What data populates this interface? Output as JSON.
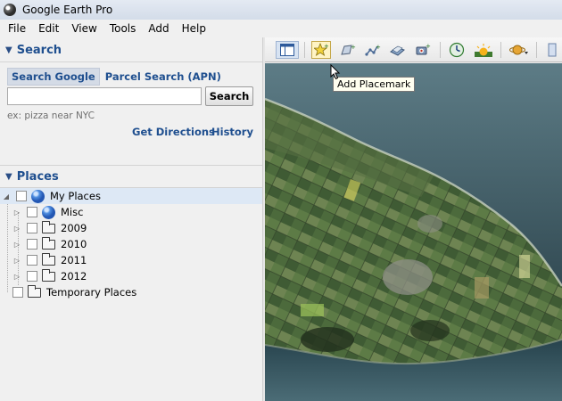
{
  "window": {
    "title": "Google Earth Pro",
    "app_icon": "google-earth-icon"
  },
  "menu": [
    "File",
    "Edit",
    "View",
    "Tools",
    "Add",
    "Help"
  ],
  "search": {
    "header": "Search",
    "tabs": [
      "Search Google",
      "Parcel Search (APN)"
    ],
    "active_tab": "Search Google",
    "input_value": "",
    "button_label": "Search",
    "hint": "ex: pizza near NYC",
    "links": [
      "Get Directions",
      "History"
    ]
  },
  "places": {
    "header": "Places",
    "items": [
      {
        "label": "My Places",
        "icon": "globe-icon",
        "selected": true
      },
      {
        "label": "Misc",
        "icon": "globe-icon"
      },
      {
        "label": "2009",
        "icon": "folder-icon"
      },
      {
        "label": "2010",
        "icon": "folder-icon"
      },
      {
        "label": "2011",
        "icon": "folder-icon"
      },
      {
        "label": "2012",
        "icon": "folder-icon"
      },
      {
        "label": "Temporary Places",
        "icon": "folder-icon"
      }
    ]
  },
  "toolbar": {
    "buttons": [
      "sidebar-toggle-icon",
      "placemark-icon",
      "polygon-icon",
      "path-icon",
      "image-overlay-icon",
      "record-tour-icon",
      "historical-imagery-icon",
      "sunlight-icon",
      "planets-icon"
    ],
    "tooltip": "Add Placemark"
  },
  "colors": {
    "accent": "#1f4f8f",
    "selected_row": "#dde8f5",
    "sea": "#20363e"
  }
}
